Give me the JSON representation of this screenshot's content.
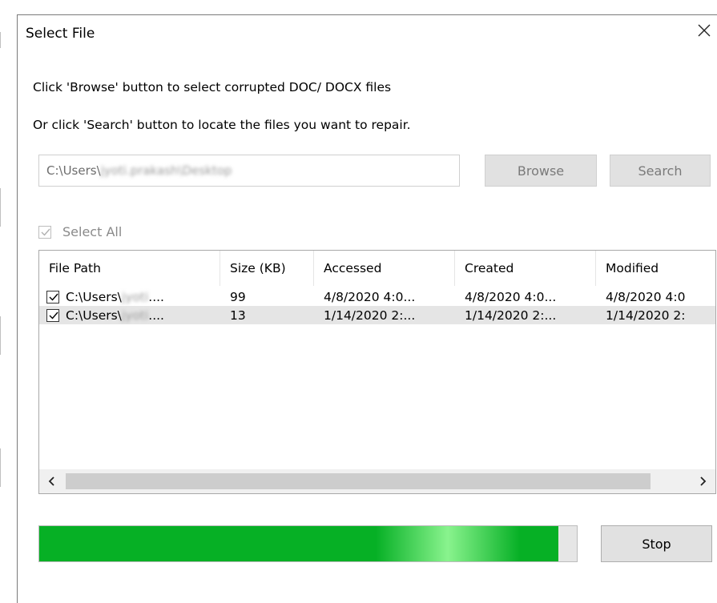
{
  "dialog": {
    "title": "Select File",
    "instruction_line1": "Click 'Browse' button to select corrupted DOC/ DOCX files",
    "instruction_line2": "Or click 'Search' button to locate the files you want to repair.",
    "path": {
      "prefix": "C:\\Users\\",
      "blurred": "jyoti.prakash\\Desktop"
    },
    "browse_label": "Browse",
    "search_label": "Search",
    "select_all_label": "Select All",
    "stop_label": "Stop"
  },
  "table": {
    "columns": [
      "File Path",
      "Size (KB)",
      "Accessed",
      "Created",
      "Modified"
    ],
    "rows": [
      {
        "path_prefix": "C:\\Users\\",
        "path_blur": "jyoti",
        "path_suffix": "....",
        "size": "99",
        "accessed": "4/8/2020 4:0...",
        "created": "4/8/2020 4:0...",
        "modified": "4/8/2020 4:0",
        "checked": true
      },
      {
        "path_prefix": "C:\\Users\\",
        "path_blur": "jyoti",
        "path_suffix": "....",
        "size": "13",
        "accessed": "1/14/2020 2:...",
        "created": "1/14/2020 2:...",
        "modified": "1/14/2020 2:",
        "checked": true
      }
    ]
  },
  "progress": {
    "fraction": 0.965
  },
  "icons": {
    "close": "close-icon",
    "check": "check-icon",
    "scroll_left": "chevron-left-icon",
    "scroll_right": "chevron-right-icon"
  },
  "colors": {
    "progress_fill": "#06b025",
    "selected_row": "#e5e5e5",
    "disabled_text": "#7a7a7a"
  }
}
